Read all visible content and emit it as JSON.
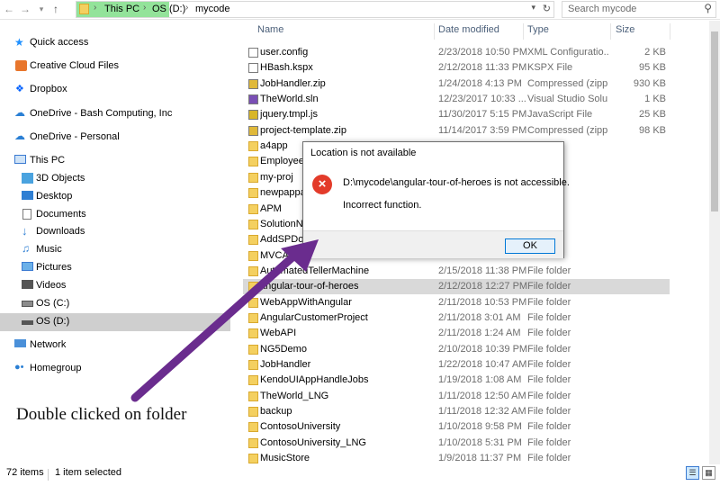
{
  "address_bar": {
    "crumbs": [
      "This PC",
      "OS (D:)",
      "mycode"
    ],
    "search_placeholder": "Search mycode",
    "highlight_color": "#93e39a"
  },
  "nav_pane": {
    "items": [
      {
        "label": "Quick access",
        "icon": "star-icon"
      },
      {
        "label": "Creative Cloud Files",
        "icon": "creative-cloud-icon"
      },
      {
        "label": "Dropbox",
        "icon": "dropbox-icon"
      },
      {
        "label": "OneDrive - Bash Computing, Inc",
        "icon": "onedrive-icon"
      },
      {
        "label": "OneDrive - Personal",
        "icon": "onedrive-icon"
      },
      {
        "label": "This PC",
        "icon": "computer-icon"
      },
      {
        "label": "3D Objects",
        "icon": "3d-objects-icon"
      },
      {
        "label": "Desktop",
        "icon": "desktop-icon"
      },
      {
        "label": "Documents",
        "icon": "documents-icon"
      },
      {
        "label": "Downloads",
        "icon": "downloads-icon"
      },
      {
        "label": "Music",
        "icon": "music-icon"
      },
      {
        "label": "Pictures",
        "icon": "pictures-icon"
      },
      {
        "label": "Videos",
        "icon": "videos-icon"
      },
      {
        "label": "OS (C:)",
        "icon": "drive-icon"
      },
      {
        "label": "OS (D:)",
        "icon": "drive-icon"
      },
      {
        "label": "Network",
        "icon": "network-icon"
      },
      {
        "label": "Homegroup",
        "icon": "homegroup-icon"
      }
    ]
  },
  "columns": {
    "name": "Name",
    "date": "Date modified",
    "type": "Type",
    "size": "Size"
  },
  "files": [
    {
      "name": "user.config",
      "date": "2/23/2018 10:50 PM",
      "type": "XML Configuratio...",
      "size": "2 KB",
      "icon": "config-file-icon"
    },
    {
      "name": "HBash.kspx",
      "date": "2/12/2018 11:33 PM",
      "type": "KSPX File",
      "size": "95 KB",
      "icon": "file-icon"
    },
    {
      "name": "JobHandler.zip",
      "date": "1/24/2018 4:13 PM",
      "type": "Compressed (zipp...",
      "size": "930 KB",
      "icon": "zip-icon"
    },
    {
      "name": "TheWorld.sln",
      "date": "12/23/2017 10:33 ...",
      "type": "Visual Studio Solu...",
      "size": "1 KB",
      "icon": "sln-icon"
    },
    {
      "name": "jquery.tmpl.js",
      "date": "11/30/2017 5:15 PM",
      "type": "JavaScript File",
      "size": "25 KB",
      "icon": "js-file-icon"
    },
    {
      "name": "project-template.zip",
      "date": "11/14/2017 3:59 PM",
      "type": "Compressed (zipp...",
      "size": "98 KB",
      "icon": "zip-icon"
    },
    {
      "name": "a4app",
      "date": "",
      "type": "",
      "size": "",
      "icon": "folder-icon"
    },
    {
      "name": "Employees",
      "date": "",
      "type": "",
      "size": "",
      "icon": "folder-icon"
    },
    {
      "name": "my-proj",
      "date": "",
      "type": "",
      "size": "",
      "icon": "folder-icon"
    },
    {
      "name": "newpappas",
      "date": "",
      "type": "",
      "size": "",
      "icon": "folder-icon"
    },
    {
      "name": "APM",
      "date": "",
      "type": "",
      "size": "",
      "icon": "folder-icon"
    },
    {
      "name": "SolutionNa",
      "date": "",
      "type": "",
      "size": "",
      "icon": "folder-icon"
    },
    {
      "name": "AddSPDoc",
      "date": "",
      "type": "",
      "size": "",
      "icon": "folder-icon"
    },
    {
      "name": "MVCAuto",
      "date": "",
      "type": "",
      "size": "",
      "icon": "folder-icon"
    },
    {
      "name": "AutomatedTellerMachine",
      "date": "2/15/2018 11:38 PM",
      "type": "File folder",
      "size": "",
      "icon": "folder-icon"
    },
    {
      "name": "angular-tour-of-heroes",
      "date": "2/12/2018 12:27 PM",
      "type": "File folder",
      "size": "",
      "icon": "folder-icon",
      "selected": true
    },
    {
      "name": "WebAppWithAngular",
      "date": "2/11/2018 10:53 PM",
      "type": "File folder",
      "size": "",
      "icon": "folder-icon"
    },
    {
      "name": "AngularCustomerProject",
      "date": "2/11/2018 3:01 AM",
      "type": "File folder",
      "size": "",
      "icon": "folder-icon"
    },
    {
      "name": "WebAPI",
      "date": "2/11/2018 1:24 AM",
      "type": "File folder",
      "size": "",
      "icon": "folder-icon"
    },
    {
      "name": "NG5Demo",
      "date": "2/10/2018 10:39 PM",
      "type": "File folder",
      "size": "",
      "icon": "folder-icon"
    },
    {
      "name": "JobHandler",
      "date": "1/22/2018 10:47 AM",
      "type": "File folder",
      "size": "",
      "icon": "folder-icon"
    },
    {
      "name": "KendoUIAppHandleJobs",
      "date": "1/19/2018 1:08 AM",
      "type": "File folder",
      "size": "",
      "icon": "folder-icon"
    },
    {
      "name": "TheWorld_LNG",
      "date": "1/11/2018 12:50 AM",
      "type": "File folder",
      "size": "",
      "icon": "folder-icon"
    },
    {
      "name": "backup",
      "date": "1/11/2018 12:32 AM",
      "type": "File folder",
      "size": "",
      "icon": "folder-icon"
    },
    {
      "name": "ContosoUniversity",
      "date": "1/10/2018 9:58 PM",
      "type": "File folder",
      "size": "",
      "icon": "folder-icon"
    },
    {
      "name": "ContosoUniversity_LNG",
      "date": "1/10/2018 5:31 PM",
      "type": "File folder",
      "size": "",
      "icon": "folder-icon"
    },
    {
      "name": "MusicStore",
      "date": "1/9/2018 11:37 PM",
      "type": "File folder",
      "size": "",
      "icon": "folder-icon"
    }
  ],
  "dialog": {
    "title": "Location is not available",
    "message": "D:\\mycode\\angular-tour-of-heroes is not accessible.",
    "detail": "Incorrect function.",
    "ok_label": "OK",
    "error_symbol": "×",
    "error_color": "#e33b2a"
  },
  "annotation": {
    "caption": "Double clicked on folder",
    "arrow_color": "#6a2c8e"
  },
  "status": {
    "item_count": "72 items",
    "selection": "1 item selected"
  }
}
